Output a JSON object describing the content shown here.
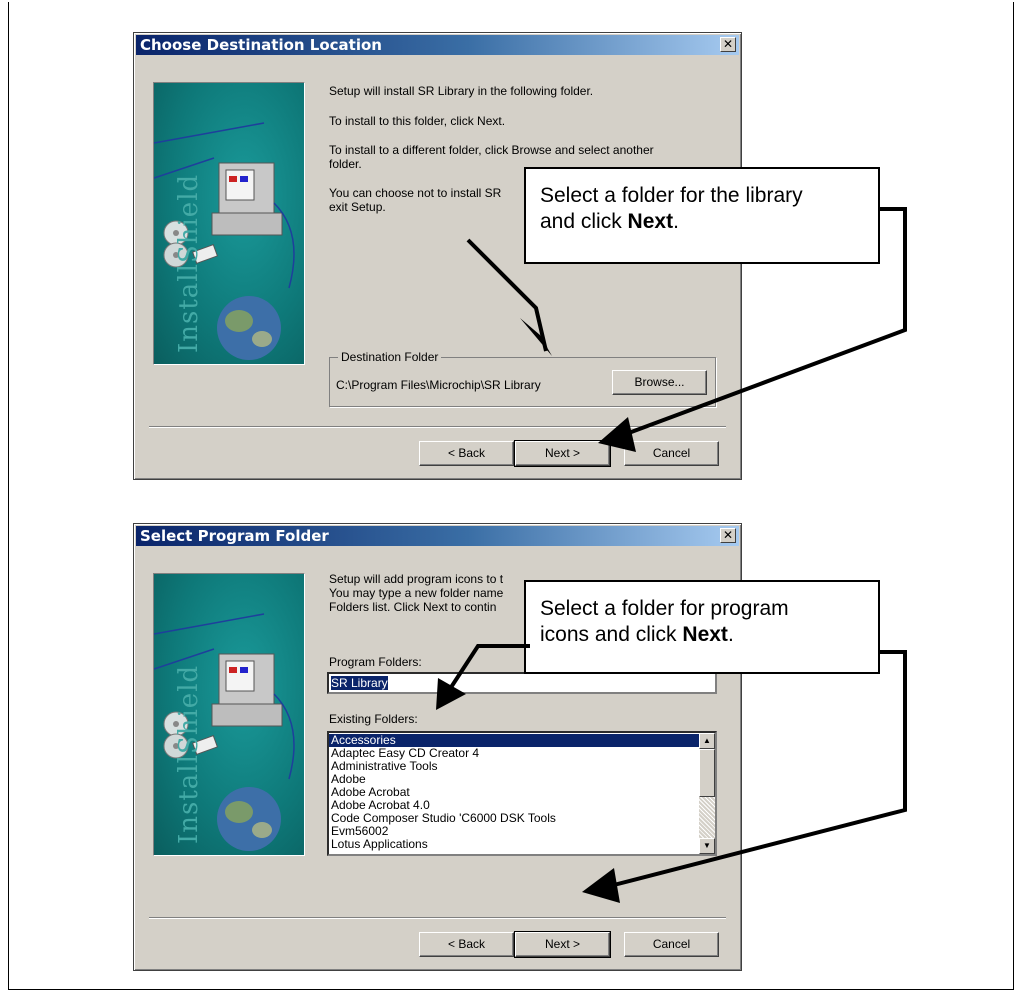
{
  "dialog1": {
    "title": "Choose Destination Location",
    "close_glyph": "✕",
    "brand": "InstallShield",
    "line1": "Setup will install SR Library in the following folder.",
    "line2": "To install to this folder, click Next.",
    "line3a": "To install to a different folder, click Browse and select another",
    "line3b": "folder.",
    "line4a": "You can choose not to install SR",
    "line4b": "exit Setup.",
    "group_label": "Destination Folder",
    "path": "C:\\Program Files\\Microchip\\SR Library",
    "browse_label": "Browse...",
    "back_label": "< Back",
    "next_label": "Next >",
    "cancel_label": "Cancel",
    "callout_line1": "Select a folder for the library",
    "callout_line2": "and click ",
    "callout_bold": "Next",
    "callout_end": "."
  },
  "dialog2": {
    "title": "Select Program Folder",
    "close_glyph": "✕",
    "brand": "InstallShield",
    "line1": "Setup will add program icons to t",
    "line2": "You may type a new folder name",
    "line3": "Folders list.  Click Next to contin",
    "program_folders_label": "Program Folders:",
    "program_folder_value": "SR Library",
    "existing_folders_label": "Existing Folders:",
    "folders": [
      "Accessories",
      "Adaptec Easy CD Creator 4",
      "Administrative Tools",
      "Adobe",
      "Adobe Acrobat",
      "Adobe Acrobat 4.0",
      "Code Composer Studio 'C6000 DSK Tools",
      "Evm56002",
      "Lotus Applications"
    ],
    "back_label": "< Back",
    "next_label": "Next >",
    "cancel_label": "Cancel",
    "callout_line1": "Select a folder for program",
    "callout_line2": "icons and click ",
    "callout_bold": "Next",
    "callout_end": "."
  },
  "colors": {
    "dialog_face": "#d4d0c8",
    "title_gradient_start": "#0a246a",
    "panel_teal": "#0e7878",
    "selection": "#0a246a"
  }
}
